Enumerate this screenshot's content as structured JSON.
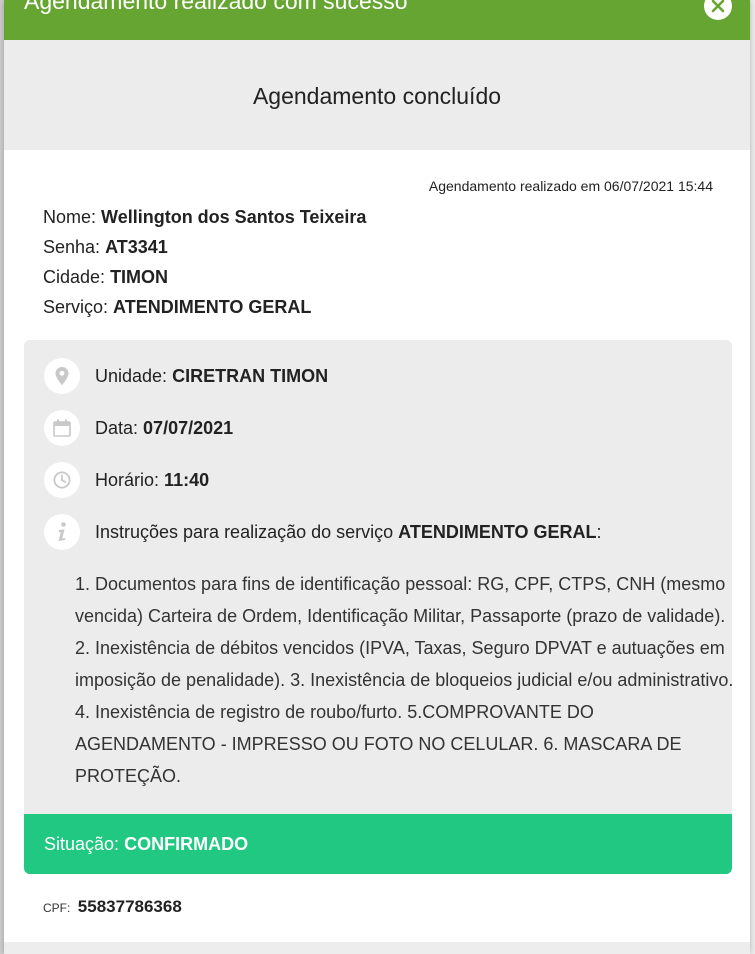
{
  "header": {
    "title": "Agendamento realizado com sucesso"
  },
  "subheader": {
    "title": "Agendamento concluído"
  },
  "timestamp": "Agendamento realizado em 06/07/2021 15:44",
  "person": {
    "name_label": "Nome:",
    "name_value": "Wellington dos Santos Teixeira",
    "senha_label": "Senha:",
    "senha_value": "AT3341",
    "cidade_label": "Cidade:",
    "cidade_value": "TIMON",
    "servico_label": "Serviço:",
    "servico_value": "ATENDIMENTO GERAL"
  },
  "details": {
    "unidade_label": "Unidade:",
    "unidade_value": "CIRETRAN TIMON",
    "data_label": "Data:",
    "data_value": "07/07/2021",
    "horario_label": "Horário:",
    "horario_value": "11:40",
    "instr_label": "Instruções para realização do serviço",
    "instr_service": "ATENDIMENTO GERAL",
    "instr_colon": ":",
    "instructions_text": "1. Documentos para fins de identificação pessoal: RG, CPF, CTPS, CNH (mesmo vencida) Carteira de Ordem, Identificação Militar, Passaporte (prazo de validade). 2. Inexistência de débitos vencidos (IPVA, Taxas, Seguro DPVAT e autuações em imposição de penalidade). 3. Inexistência de bloqueios judicial e/ou administrativo. 4. Inexistência de registro de roubo/furto. 5.COMPROVANTE DO AGENDAMENTO - IMPRESSO OU FOTO NO CELULAR. 6. MASCARA DE PROTEÇÃO."
  },
  "status": {
    "label": "Situação:",
    "value": "CONFIRMADO",
    "color": "#21c882"
  },
  "cpf": {
    "label": "CPF:",
    "value": "55837786368"
  },
  "icons": {
    "unidade": "map-pin-icon",
    "data": "calendar-icon",
    "horario": "clock-icon",
    "instrucoes": "info-icon",
    "close": "close-icon"
  },
  "colors": {
    "header": "#66a532",
    "card": "#ececec"
  }
}
